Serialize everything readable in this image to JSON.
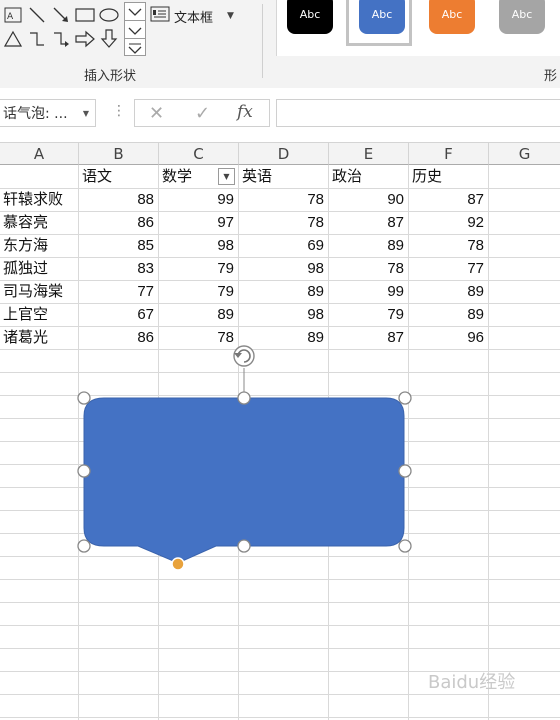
{
  "ribbon": {
    "textbox_label": "文本框",
    "insert_shapes_group_label": "插入形状",
    "shape_styles_group_label": "形",
    "style_swatches": [
      {
        "label": "Abc",
        "color": "#000000"
      },
      {
        "label": "Abc",
        "color": "#4472c4"
      },
      {
        "label": "Abc",
        "color": "#ed7d31"
      },
      {
        "label": "Abc",
        "color": "#a5a5a5"
      }
    ],
    "shape_icons": [
      "text-box-icon",
      "line-icon",
      "arrow-line-icon",
      "rectangle-icon",
      "oval-icon",
      "triangle-icon",
      "elbow-connector-icon",
      "elbow-arrow-icon",
      "right-arrow-icon",
      "down-arrow-icon"
    ]
  },
  "formula_bar": {
    "name_box": "话气泡: ...",
    "cancel_glyph": "✕",
    "enter_glyph": "✓",
    "fx_glyph": "fx",
    "formula": ""
  },
  "sheet": {
    "columns": [
      "A",
      "B",
      "C",
      "D",
      "E",
      "F",
      "G"
    ],
    "headers": [
      "",
      "语文",
      "数学",
      "英语",
      "政治",
      "历史"
    ],
    "rows": [
      {
        "name": "轩辕求败",
        "scores": [
          "88",
          "99",
          "78",
          "90",
          "87"
        ]
      },
      {
        "name": "慕容亮",
        "scores": [
          "86",
          "97",
          "78",
          "87",
          "92"
        ]
      },
      {
        "name": "东方海",
        "scores": [
          "85",
          "98",
          "69",
          "89",
          "78"
        ]
      },
      {
        "name": "孤独过",
        "scores": [
          "83",
          "79",
          "98",
          "78",
          "77"
        ]
      },
      {
        "name": "司马海棠",
        "scores": [
          "77",
          "79",
          "89",
          "99",
          "89"
        ]
      },
      {
        "name": "上官空",
        "scores": [
          "67",
          "89",
          "98",
          "79",
          "89"
        ]
      },
      {
        "name": "诸葛光",
        "scores": [
          "86",
          "78",
          "89",
          "87",
          "96"
        ]
      }
    ]
  },
  "shape": {
    "fill_color": "#4472c4",
    "handle_color": "#e8a23c",
    "rotate_icon": "⟳"
  },
  "watermark": "Baidu经验"
}
